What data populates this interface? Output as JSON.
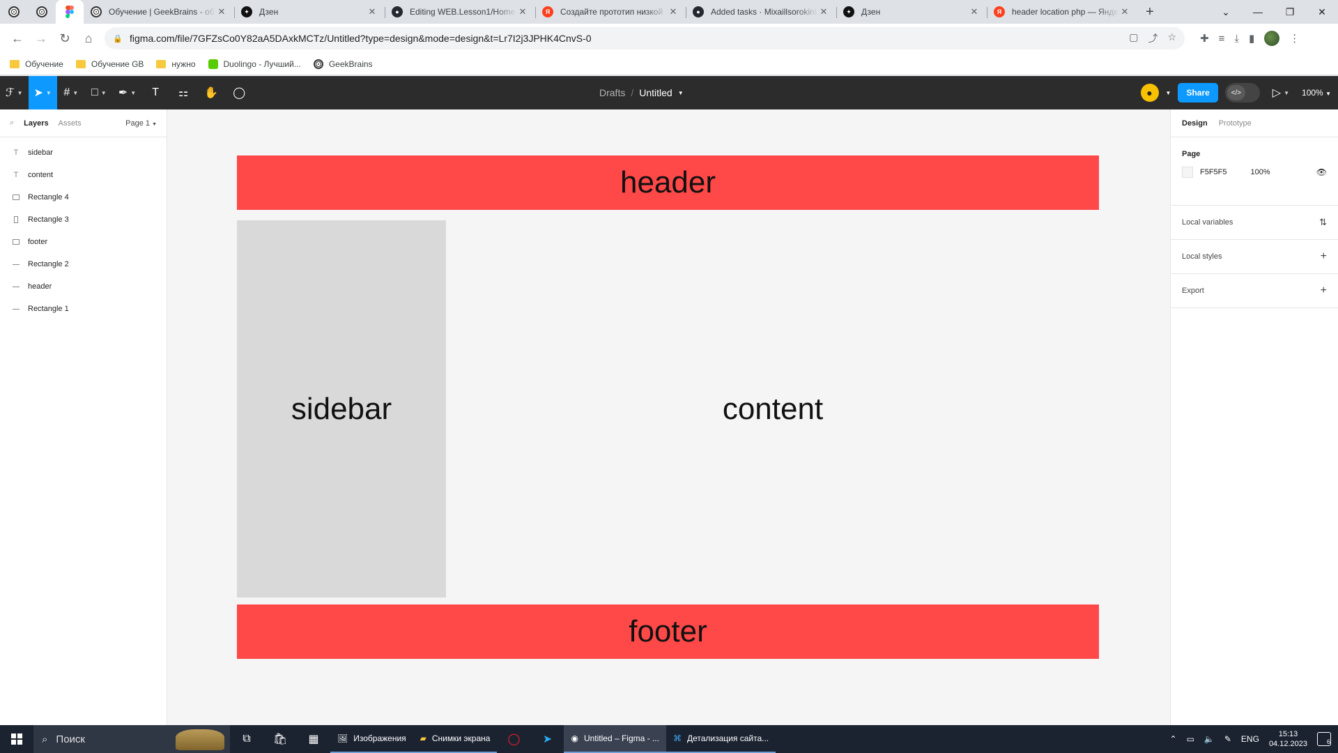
{
  "browser": {
    "tabs": [
      {
        "title": "Обучение | GeekBrains - об",
        "favicon": "geekbrains-icon"
      },
      {
        "title": "Дзен",
        "favicon": "dzen-icon"
      },
      {
        "title": "Editing WEB.Lesson1/Home",
        "favicon": "github-icon"
      },
      {
        "title": "Создайте прототип низкой",
        "favicon": "yandex-icon"
      },
      {
        "title": "Added tasks · MixaillsorokinL",
        "favicon": "github-icon"
      },
      {
        "title": "Дзен",
        "favicon": "dzen-icon"
      },
      {
        "title": "header location php — Янде",
        "favicon": "yandex-icon"
      }
    ],
    "url": "figma.com/file/7GFZsCo0Y82aA5DAxkMCTz/Untitled?type=design&mode=design&t=Lr7I2j3JPHK4CnvS-0",
    "bookmarks": [
      "Обучение",
      "Обучение GB",
      "нужно",
      "Duolingo - Лучший...",
      "GeekBrains"
    ]
  },
  "figma": {
    "breadcrumb_drafts": "Drafts",
    "file_name": "Untitled",
    "share_label": "Share",
    "zoom": "100%",
    "left_tabs": {
      "layers": "Layers",
      "assets": "Assets",
      "page": "Page 1"
    },
    "layers": [
      {
        "name": "sidebar",
        "type": "text"
      },
      {
        "name": "content",
        "type": "text"
      },
      {
        "name": "Rectangle 4",
        "type": "rect"
      },
      {
        "name": "Rectangle 3",
        "type": "tall"
      },
      {
        "name": "footer",
        "type": "rect"
      },
      {
        "name": "Rectangle 2",
        "type": "line"
      },
      {
        "name": "header",
        "type": "line"
      },
      {
        "name": "Rectangle 1",
        "type": "line"
      }
    ],
    "canvas": {
      "header": "header",
      "sidebar": "sidebar",
      "content": "content",
      "footer": "footer",
      "accent": "#ff4848",
      "sidebar_color": "#d9d9d9"
    },
    "right": {
      "design_tab": "Design",
      "prototype_tab": "Prototype",
      "page_title": "Page",
      "page_color": "F5F5F5",
      "page_opacity": "100%",
      "local_variables": "Local variables",
      "local_styles": "Local styles",
      "export": "Export"
    }
  },
  "taskbar": {
    "search_placeholder": "Поиск",
    "apps": [
      "Изображения",
      "Снимки экрана",
      "Untitled – Figma - ...",
      "Детализация сайта..."
    ],
    "lang": "ENG",
    "time": "15:13",
    "date": "04.12.2023",
    "notifications": "6"
  }
}
